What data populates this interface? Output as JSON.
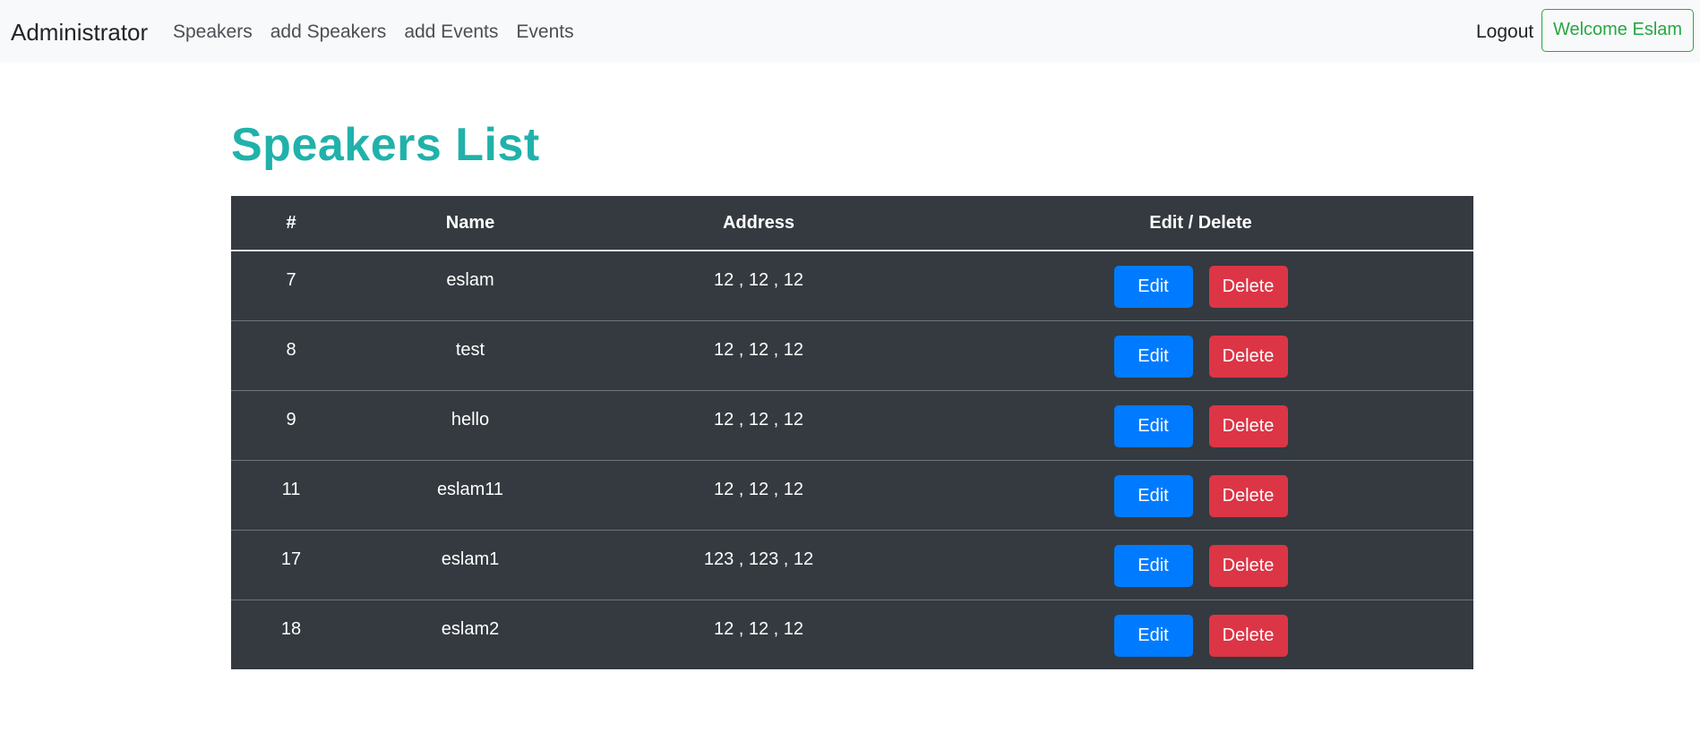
{
  "navbar": {
    "brand": "Administrator",
    "links": [
      "Speakers",
      "add Speakers",
      "add Events",
      "Events"
    ],
    "logout": "Logout",
    "welcome": "Welcome Eslam"
  },
  "page": {
    "title": "Speakers List"
  },
  "table": {
    "headers": [
      "#",
      "Name",
      "Address",
      "Edit / Delete"
    ],
    "rows": [
      {
        "id": "7",
        "name": "eslam",
        "address": "12 , 12 , 12"
      },
      {
        "id": "8",
        "name": "test",
        "address": "12 , 12 , 12"
      },
      {
        "id": "9",
        "name": "hello",
        "address": "12 , 12 , 12"
      },
      {
        "id": "11",
        "name": "eslam11",
        "address": "12 , 12 , 12"
      },
      {
        "id": "17",
        "name": "eslam1",
        "address": "123 , 123 , 12"
      },
      {
        "id": "18",
        "name": "eslam2",
        "address": "12 , 12 , 12"
      }
    ],
    "edit_label": "Edit",
    "delete_label": "Delete"
  },
  "colors": {
    "title": "#20b2aa",
    "table_bg": "#343a40",
    "edit_button": "#007bff",
    "delete_button": "#dc3545",
    "welcome_button": "#28a745"
  }
}
